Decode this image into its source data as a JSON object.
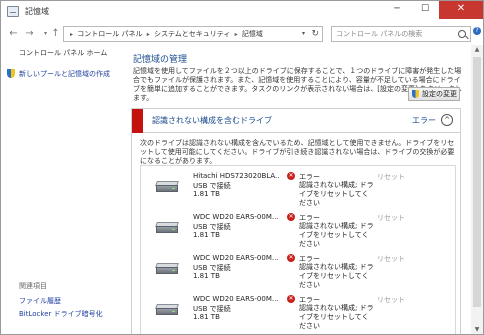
{
  "window": {
    "title": "記憶域",
    "minimize": "─",
    "maximize": "☐",
    "close": "✕"
  },
  "address": {
    "back": "←",
    "forward": "→",
    "up": "↑",
    "breadcrumbs": [
      "コントロール パネル",
      "システムとセキュリティ",
      "記憶域"
    ],
    "search_placeholder": "コントロール パネルの検索",
    "help": "?"
  },
  "sidebar": {
    "home": "コントロール パネル ホーム",
    "new_pool": "新しいプールと記憶域の作成",
    "related_heading": "関連項目",
    "related_links": [
      "ファイル履歴",
      "BitLocker ドライブ暗号化"
    ]
  },
  "main": {
    "title": "記憶域の管理",
    "description": "記憶域を使用してファイルを２つ以上のドライブに保存することで、１つのドライブに障害が発生した場合でもファイルが保護されます。また、記憶域を使用することにより、容量が不足している場合にドライブを簡単に追加することができます。タスクのリンクが表示されない場合は、[設定の変更] をクリックします。",
    "change_settings": "設定の変更"
  },
  "panel": {
    "title": "認識されない構成を含むドライブ",
    "status": "エラー",
    "collapse": "^",
    "description": "次のドライブは認識されない構成を含んでいるため、記憶域として使用できません。ドライブをリセットして使用可能にしてください。ドライブが引き続き認識されない場合は、ドライブの交換が必要になることがあります。",
    "drives": [
      {
        "name": "Hitachi HDS723020BLA...",
        "connection": "USB で接続",
        "size": "1.81 TB",
        "status": "エラー",
        "message": "認識されない構成; ドライブをリセットしてください",
        "action": "リセット"
      },
      {
        "name": "WDC WD20 EARS-00M...",
        "connection": "USB で接続",
        "size": "1.81 TB",
        "status": "エラー",
        "message": "認識されない構成; ドライブをリセットしてください",
        "action": "リセット"
      },
      {
        "name": "WDC WD20 EARS-00M...",
        "connection": "USB で接続",
        "size": "1.81 TB",
        "status": "エラー",
        "message": "認識されない構成; ドライブをリセットしてください",
        "action": "リセット"
      },
      {
        "name": "WDC WD20 EARS-00M...",
        "connection": "USB で接続",
        "size": "1.81 TB",
        "status": "エラー",
        "message": "認識されない構成; ドライブをリセットしてください",
        "action": "リセット"
      }
    ]
  }
}
